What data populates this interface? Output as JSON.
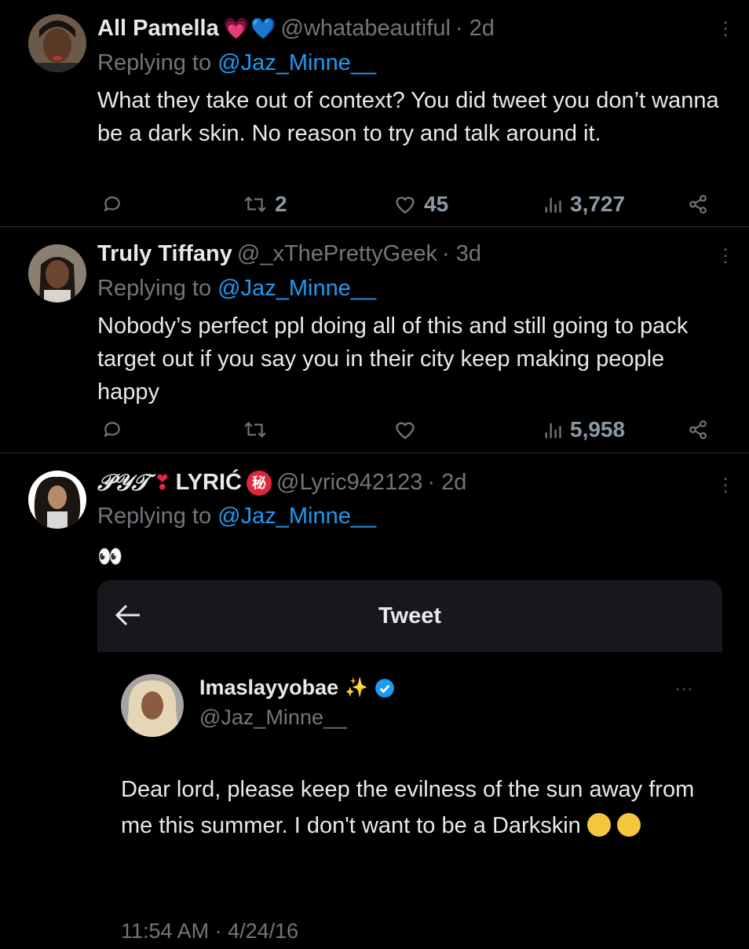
{
  "tweets": [
    {
      "display_name": "All Pamella",
      "handle": "@whatabeautiful",
      "time": "· 2d",
      "replying_prefix": "Replying to",
      "replying_to": "@Jaz_Minne__",
      "text": "What they take out of context? You did tweet you don’t  wanna be a dark skin. No reason to try and talk around it.",
      "retweets": "2",
      "likes": "45",
      "views": "3,727"
    },
    {
      "display_name": "Truly Tiffany",
      "handle": "@_xThePrettyGeek",
      "time": "· 3d",
      "replying_prefix": "Replying to",
      "replying_to": "@Jaz_Minne__",
      "text": "Nobody’s perfect ppl doing all of this and still going to pack target out if you say you in their city keep making people happy",
      "retweets": "",
      "likes": "",
      "views": "5,958"
    },
    {
      "display_name_prefix": "𝒫𝒴𝒯",
      "display_name": "LYRIĆ",
      "handle": "@Lyric942123",
      "time": "· 2d",
      "replying_prefix": "Replying to",
      "replying_to": "@Jaz_Minne__",
      "text": "👀"
    }
  ],
  "embedded": {
    "header_title": "Tweet",
    "name": "Imaslayyobae",
    "handle": "@Jaz_Minne__",
    "text": "Dear lord, please keep the evilness of the sun away from me this summer. I don't want to be a Darkskin",
    "timestamp": "11:54 AM · 4/24/16"
  },
  "colors": {
    "background": "#000000",
    "text": "#e7e9ea",
    "muted": "#71767b",
    "accent": "#1d9bf0"
  }
}
